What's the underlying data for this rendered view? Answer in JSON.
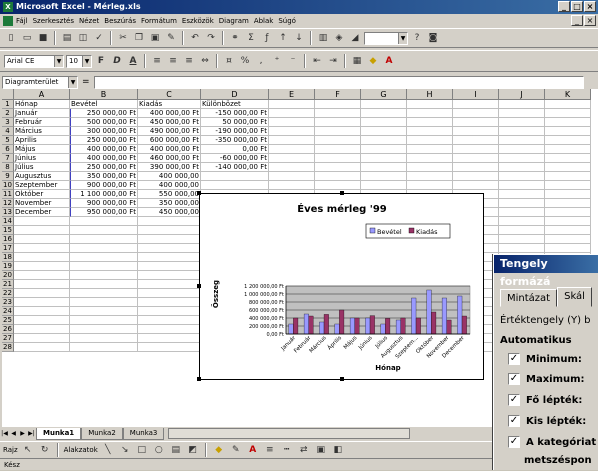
{
  "window": {
    "title": "Microsoft Excel - Mérleg.xls",
    "app_icon": "excel-icon",
    "win_buttons": [
      "_",
      "□",
      "×"
    ]
  },
  "menu": {
    "items": [
      "Fájl",
      "Szerkesztés",
      "Nézet",
      "Beszúrás",
      "Formátum",
      "Eszközök",
      "Diagram",
      "Ablak",
      "Súgó"
    ],
    "doc_buttons": [
      "_",
      "×"
    ]
  },
  "toolbar": {
    "font_name": "Arial CE",
    "font_size": "10",
    "bold": "F",
    "italic": "D",
    "underline": "A",
    "zoom": ""
  },
  "formula_bar": {
    "name_box": "Diagramterület",
    "eq": "="
  },
  "columns": [
    "A",
    "B",
    "C",
    "D",
    "E",
    "F",
    "G",
    "H",
    "I",
    "J",
    "K"
  ],
  "rows": [
    [
      "Hónap",
      "Bevétel",
      "Kiadás",
      "Különbözet"
    ],
    [
      "Január",
      "250 000,00 Ft",
      "400 000,00 Ft",
      "-150 000,00 Ft"
    ],
    [
      "Február",
      "500 000,00 Ft",
      "450 000,00 Ft",
      "50 000,00 Ft"
    ],
    [
      "Március",
      "300 000,00 Ft",
      "490 000,00 Ft",
      "-190 000,00 Ft"
    ],
    [
      "Április",
      "250 000,00 Ft",
      "600 000,00 Ft",
      "-350 000,00 Ft"
    ],
    [
      "Május",
      "400 000,00 Ft",
      "400 000,00 Ft",
      "0,00 Ft"
    ],
    [
      "Június",
      "400 000,00 Ft",
      "460 000,00 Ft",
      "-60 000,00 Ft"
    ],
    [
      "Július",
      "250 000,00 Ft",
      "390 000,00 Ft",
      "-140 000,00 Ft"
    ],
    [
      "Augusztus",
      "350 000,00 Ft",
      "400 000,00",
      ""
    ],
    [
      "Szeptember",
      "900 000,00 Ft",
      "400 000,00",
      ""
    ],
    [
      "Október",
      "1 100 000,00 Ft",
      "550 000,00",
      ""
    ],
    [
      "November",
      "900 000,00 Ft",
      "350 000,00",
      ""
    ],
    [
      "December",
      "950 000,00 Ft",
      "450 000,00",
      ""
    ]
  ],
  "row_count": 28,
  "chart_data": {
    "type": "bar",
    "title": "Éves mérleg '99",
    "xlabel": "Hónap",
    "ylabel": "Összeg",
    "legend_position": "top-right",
    "categories": [
      "Január",
      "Február",
      "Március",
      "Április",
      "Május",
      "Június",
      "Július",
      "Augusztus",
      "Szeptem...",
      "Október",
      "November",
      "December"
    ],
    "series": [
      {
        "name": "Bevétel",
        "color": "#9999ff",
        "values": [
          250000,
          500000,
          300000,
          250000,
          400000,
          400000,
          250000,
          350000,
          900000,
          1100000,
          900000,
          950000
        ]
      },
      {
        "name": "Kiadás",
        "color": "#993366",
        "values": [
          400000,
          450000,
          490000,
          600000,
          400000,
          460000,
          390000,
          400000,
          400000,
          550000,
          350000,
          450000
        ]
      }
    ],
    "ytick_labels": [
      "1 200 000,00 Ft",
      "1 000 000,00 Ft",
      "800 000,00 Ft",
      "600 000,00 Ft",
      "400 000,00 Ft",
      "200 000,00 Ft",
      "0,00 Ft"
    ],
    "ylim": [
      0,
      1200000
    ],
    "grid": true
  },
  "dialog": {
    "title": "Tengely formázá",
    "tabs": [
      "Mintázat",
      "Skál"
    ],
    "axis_label": "Értéktengely (Y) b",
    "auto_label": "Automatikus",
    "checks": [
      {
        "label": "Minimum:",
        "checked": "✓"
      },
      {
        "label": "Maximum:",
        "checked": "✓"
      },
      {
        "label": "Fő lépték:",
        "checked": "✓"
      },
      {
        "label": "Kis lépték:",
        "checked": "✓"
      },
      {
        "label": "A kategóriat",
        "checked": "✓"
      }
    ],
    "last_line": "metszéspon"
  },
  "sheets": [
    "Munka1",
    "Munka2",
    "Munka3"
  ],
  "drawing": {
    "draw_label": "Rajz",
    "autoshapes_label": "Alakzatok"
  },
  "status_text": "Kész"
}
